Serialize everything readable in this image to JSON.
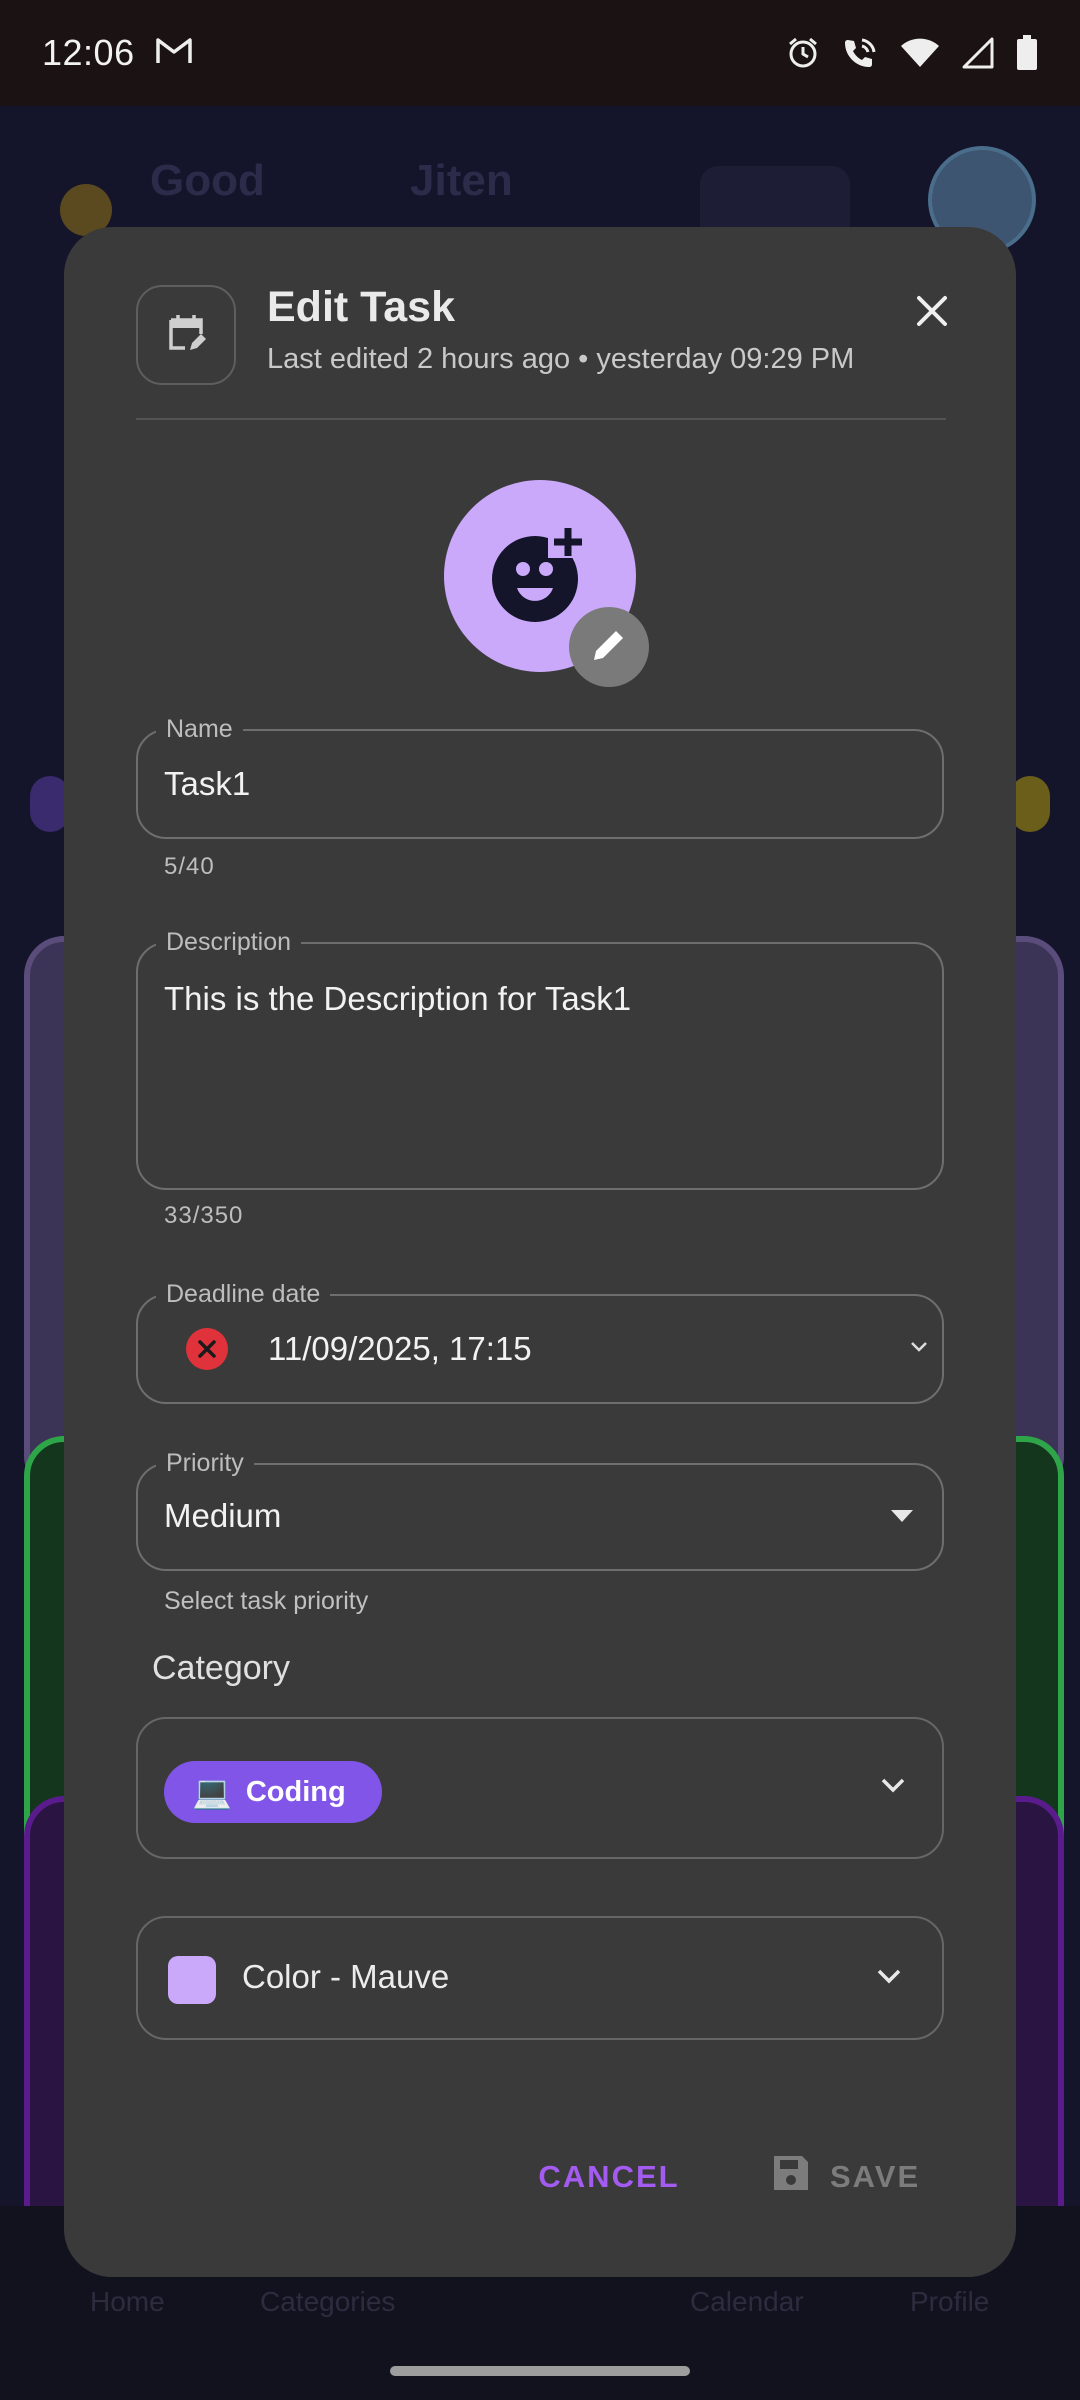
{
  "status_bar": {
    "time": "12:06",
    "icons": [
      "gmail-icon",
      "alarm-icon",
      "wifi-call-icon",
      "wifi-icon",
      "signal-icon",
      "battery-icon"
    ]
  },
  "background": {
    "greeting": "Good",
    "name": "Jiten",
    "nav_labels": [
      "Home",
      "Categories",
      "Calendar",
      "Profile"
    ]
  },
  "dialog": {
    "title": "Edit Task",
    "subtitle": "Last edited 2 hours ago • yesterday 09:29 PM",
    "icons": {
      "header": "calendar-edit-icon",
      "close": "close-icon",
      "avatar": "add-emoji-icon",
      "edit": "pencil-icon"
    },
    "name_field": {
      "label": "Name",
      "value": "Task1",
      "counter": "5/40"
    },
    "description_field": {
      "label": "Description",
      "value": "This is the Description for Task1",
      "counter": "33/350"
    },
    "deadline_field": {
      "label": "Deadline date",
      "value": "11/09/2025, 17:15"
    },
    "priority_field": {
      "label": "Priority",
      "value": "Medium",
      "helper": "Select task priority"
    },
    "category": {
      "section_title": "Category",
      "selected": "Coding",
      "emoji": "💻"
    },
    "color": {
      "label": "Color - Mauve",
      "swatch": "#caa9fb"
    },
    "actions": {
      "cancel": "CANCEL",
      "save": "SAVE"
    }
  },
  "colors": {
    "dialog_bg": "#3a3a3a",
    "accent_purple": "#a35bf0",
    "chip_purple": "#8155e8",
    "mauve": "#caa9fb",
    "error_red": "#e0323b"
  }
}
